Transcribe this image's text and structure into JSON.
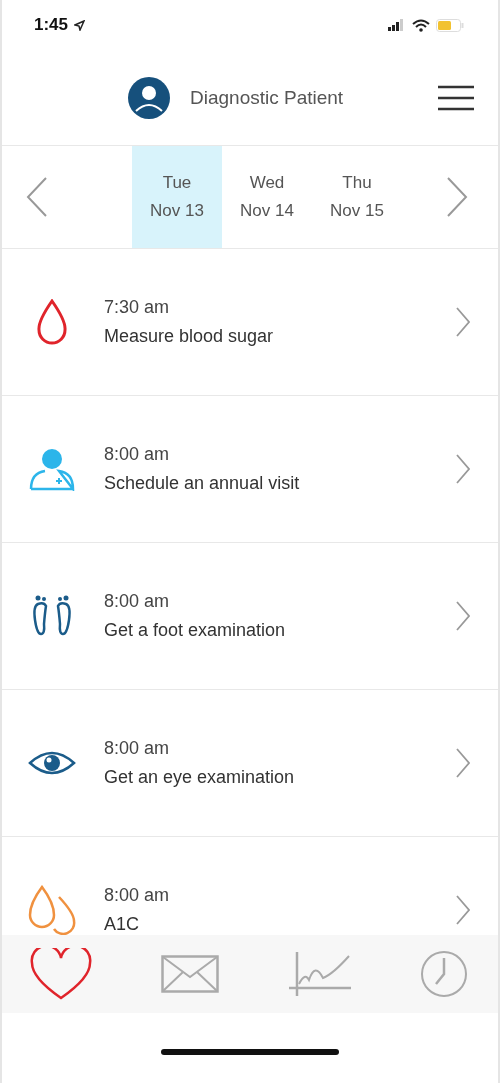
{
  "status_bar": {
    "time": "1:45"
  },
  "header": {
    "title": "Diagnostic Patient"
  },
  "days": [
    {
      "weekday": "Tue",
      "date": "Nov 13",
      "selected": true
    },
    {
      "weekday": "Wed",
      "date": "Nov 14",
      "selected": false
    },
    {
      "weekday": "Thu",
      "date": "Nov 15",
      "selected": false
    }
  ],
  "tasks": [
    {
      "kind": "drop",
      "time": "7:30 am",
      "title": "Measure blood sugar"
    },
    {
      "kind": "doctor",
      "time": "8:00 am",
      "title": "Schedule an annual visit"
    },
    {
      "kind": "feet",
      "time": "8:00 am",
      "title": "Get a foot examination"
    },
    {
      "kind": "eye",
      "time": "8:00 am",
      "title": "Get an eye examination"
    },
    {
      "kind": "drops",
      "time": "8:00 am",
      "title": "A1C"
    }
  ],
  "tab_bar": [
    {
      "kind": "heart",
      "selected": true
    },
    {
      "kind": "mail",
      "selected": false
    },
    {
      "kind": "chart",
      "selected": false
    },
    {
      "kind": "clock",
      "selected": false
    }
  ]
}
